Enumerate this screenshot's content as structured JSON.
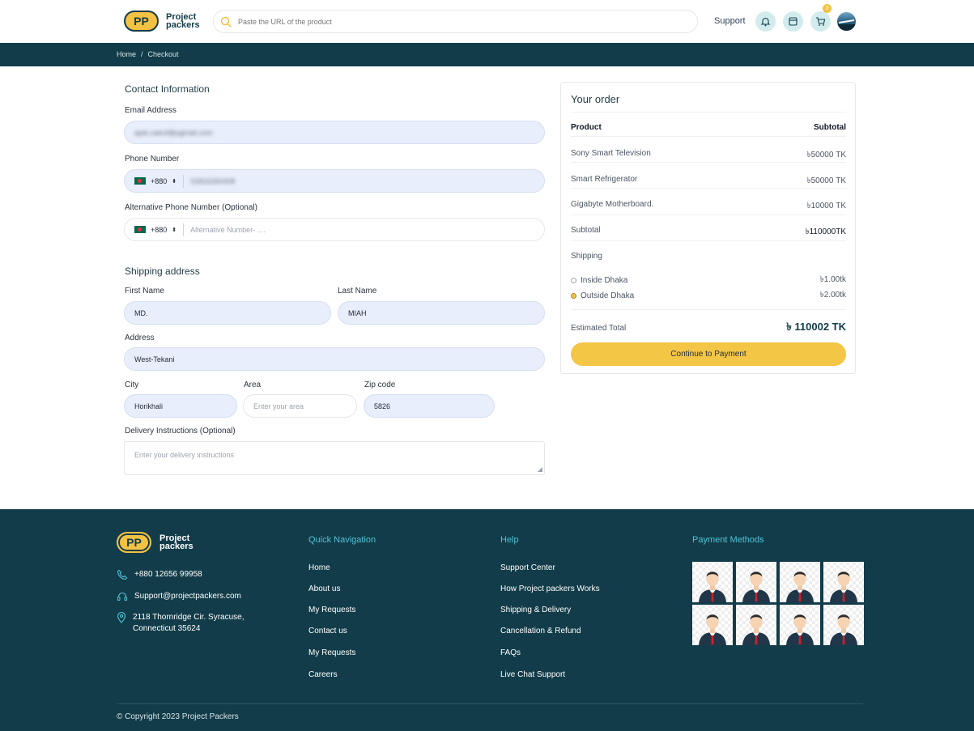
{
  "header": {
    "logo_badge": "PP",
    "logo_line1": "Project",
    "logo_line2": "packers",
    "search_placeholder": "Paste the URL of the product",
    "support_label": "Support",
    "cart_count": "3"
  },
  "breadcrumb": {
    "home": "Home",
    "separator": "/",
    "current": "Checkout"
  },
  "contact": {
    "title": "Contact Information",
    "email_label": "Email Address",
    "email_value": "apie.caeuf@pgmail.com",
    "phone_label": "Phone Number",
    "phone_code": "+880",
    "phone_value": "01816260408",
    "alt_phone_label": "Alternative Phone Number (Optional)",
    "alt_phone_code": "+880",
    "alt_phone_placeholder": "Alternative Number- ...."
  },
  "shipping": {
    "title": "Shipping address",
    "first_name_label": "First Name",
    "first_name_value": "MD.",
    "last_name_label": "Last Name",
    "last_name_value": "MIAH",
    "address_label": "Address",
    "address_value": "West-Tekani",
    "city_label": "City",
    "city_value": "Horikhali",
    "area_label": "Area",
    "area_placeholder": "Enter your area",
    "zip_label": "Zip code",
    "zip_value": "5826",
    "instructions_label": "Delivery Instructions (Optional)",
    "instructions_placeholder": "Enter your delivery instructions"
  },
  "order": {
    "title": "Your order",
    "col_product": "Product",
    "col_subtotal": "Subtotal",
    "items": [
      {
        "name": "Sony Smart Television",
        "price": "৳50000 TK"
      },
      {
        "name": "Smart Refrigerator",
        "price": "৳50000 TK"
      },
      {
        "name": "Gigabyte Motherboard.",
        "price": "৳10000 TK"
      }
    ],
    "subtotal_label": "Subtotal",
    "subtotal_value": "৳110000TK",
    "shipping_label": "Shipping",
    "shipping_options": [
      {
        "name": "Inside Dhaka",
        "price": "৳1.00tk",
        "selected": false
      },
      {
        "name": "Outside Dhaka",
        "price": "৳2.00tk",
        "selected": true
      }
    ],
    "estimated_label": "Estimated Total",
    "estimated_value": "৳ 110002 TK",
    "pay_button": "Continue to Payment"
  },
  "footer": {
    "logo_badge": "PP",
    "logo_line1": "Project",
    "logo_line2": "packers",
    "phone": "+880 12656 99958",
    "email": "Support@projectpackers.com",
    "address_line1": "2118 Thornridge Cir. Syracuse,",
    "address_line2": "Connecticut 35624",
    "nav_title": "Quick Navigation",
    "nav_links": [
      "Home",
      "About us",
      "My Requests",
      "Contact us",
      "My Requests",
      "Careers"
    ],
    "help_title": "Help",
    "help_links": [
      "Support Center",
      "How Project packers Works",
      "Shipping & Delivery",
      "Cancellation & Refund",
      "FAQs",
      "Live Chat Support"
    ],
    "payment_title": "Payment Methods",
    "copyright": "© Copyright 2023 Project Packers"
  },
  "colors": {
    "brand_dark": "#123c49",
    "brand_yellow": "#f4c242",
    "accent_cyan": "#4fc3d6"
  }
}
